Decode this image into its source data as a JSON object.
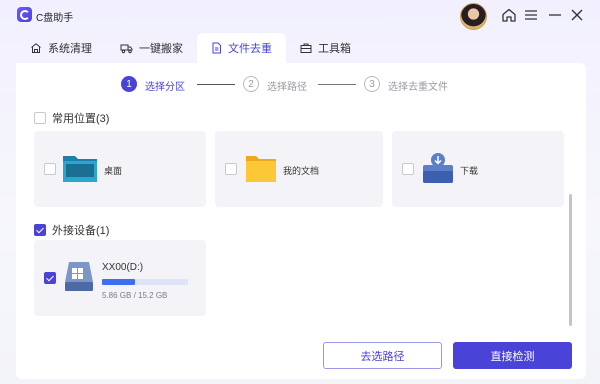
{
  "app": {
    "title": "C盘助手"
  },
  "tabs": [
    {
      "label": "系统清理",
      "icon": "home-small-icon"
    },
    {
      "label": "一键搬家",
      "icon": "truck-icon"
    },
    {
      "label": "文件去重",
      "icon": "document-icon",
      "active": true
    },
    {
      "label": "工具箱",
      "icon": "toolbox-icon"
    }
  ],
  "steps": [
    {
      "num": "1",
      "label": "选择分区",
      "active": true
    },
    {
      "num": "2",
      "label": "选择路径",
      "active": false
    },
    {
      "num": "3",
      "label": "选择去重文件",
      "active": false
    }
  ],
  "section_common": {
    "label_cut": "常用位置(3)"
  },
  "common_items": [
    {
      "label": "桌面",
      "icon": "desktop-folder-icon"
    },
    {
      "label": "我的文档",
      "icon": "folder-icon"
    },
    {
      "label": "下载",
      "icon": "download-folder-icon"
    }
  ],
  "section_external": {
    "label": "外接设备(1)",
    "checked": true
  },
  "drive": {
    "name": "XX00(D:)",
    "size": "5.86 GB / 15.2 GB",
    "used_fraction": 0.385,
    "checked": true
  },
  "buttons": {
    "secondary": "去选路径",
    "primary": "直接检测"
  },
  "colors": {
    "accent": "#4a43d8",
    "bar": "#3d6ff0"
  }
}
